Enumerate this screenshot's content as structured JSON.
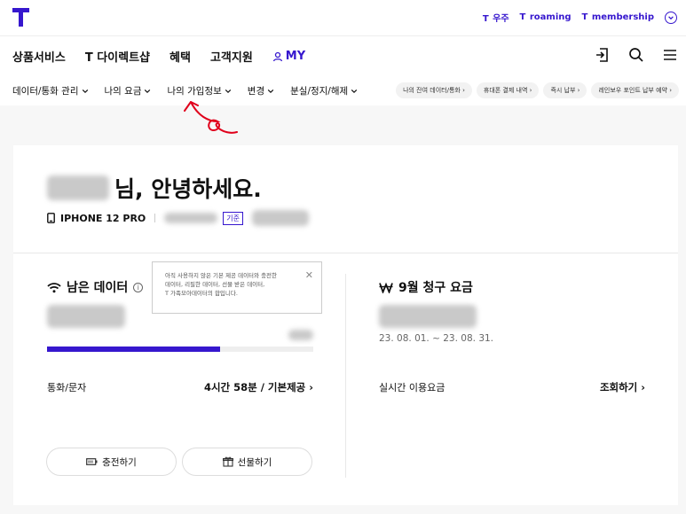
{
  "topbar": {
    "links": [
      {
        "prefix": "T",
        "label": "우주"
      },
      {
        "prefix": "T",
        "label": "roaming"
      },
      {
        "prefix": "T",
        "label": "membership"
      }
    ]
  },
  "mainnav": {
    "items": [
      "상품서비스",
      "T 다이렉트샵",
      "혜택",
      "고객지원"
    ],
    "my_label": "MY"
  },
  "subnav": {
    "items": [
      "데이터/통화 관리",
      "나의 요금",
      "나의 가입정보",
      "변경",
      "분실/정지/해제"
    ],
    "pills": [
      "나의 잔여 데이터/통화 ›",
      "휴대폰 결제 내역 ›",
      "즉시 납부 ›",
      "레인보우 포인트 납부 예약 ›"
    ]
  },
  "greeting": {
    "suffix": "님, 안녕하세요."
  },
  "device": {
    "model": "IPHONE 12 PRO",
    "badge": "기준"
  },
  "data_section": {
    "title": "남은 데이터",
    "progress_fraction": 0.65,
    "call_label": "통화/문자",
    "call_value": "4시간 58분 / 기본제공 ›",
    "charge_label": "충전하기",
    "gift_label": "선물하기"
  },
  "tooltip": {
    "lines": [
      "아직 사용하지 않은 기본 제공 데이터와 충전한",
      "데이터, 리필한 데이터, 선물 받은 데이터,",
      "T 가족모아데이터의 합입니다."
    ]
  },
  "bill_section": {
    "title": "9월 청구 요금",
    "period": "23. 08. 01. ~ 23. 08. 31.",
    "realtime_label": "실시간 이용요금",
    "realtime_link": "조회하기 ›"
  },
  "colors": {
    "brand": "#3617ce",
    "scribble": "#e0001b"
  }
}
